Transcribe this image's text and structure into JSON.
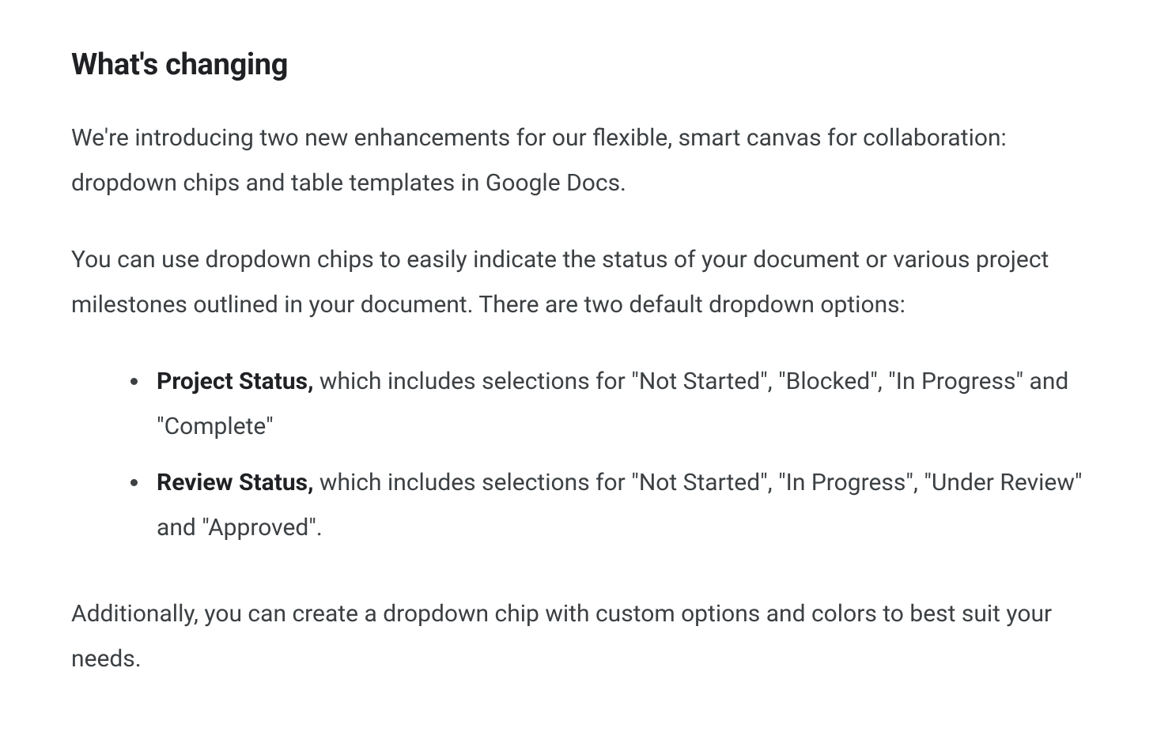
{
  "heading": "What's changing",
  "intro": "We're introducing two new enhancements for our flexible, smart canvas for collaboration: dropdown chips and table templates in Google Docs.",
  "description": "You can use dropdown chips to easily indicate the status of your document or various project milestones outlined in your document. There are two default dropdown options:",
  "bullets": [
    {
      "label": "Project Status,",
      "text": " which includes selections for \"Not Started\", \"Blocked\", \"In Progress\" and \"Complete\""
    },
    {
      "label": "Review Status,",
      "text": " which includes selections for \"Not Started\", \"In Progress\", \"Under Review\" and \"Approved\"."
    }
  ],
  "closing": "Additionally, you can create a dropdown chip with custom options and colors to best suit your needs."
}
